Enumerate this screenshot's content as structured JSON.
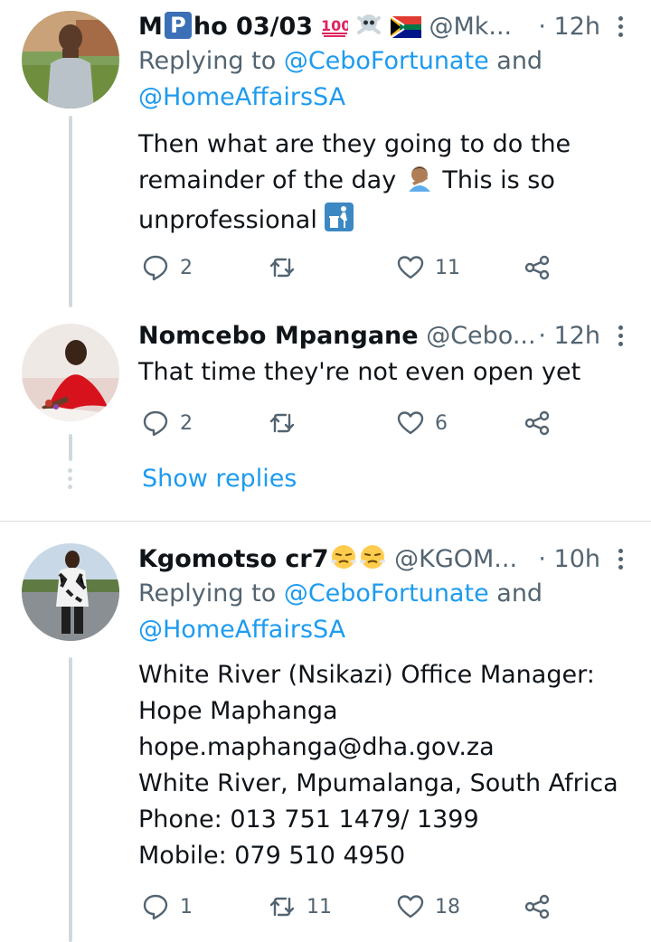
{
  "tweets": [
    {
      "name_pre": "M",
      "name_badge": "P",
      "name_post": "ho 03/03",
      "handle": "@Mk...",
      "time": "· 12h",
      "reply_prefix": "Replying to ",
      "reply_mention1": "@CeboFortunate",
      "reply_and": " and",
      "reply_mention2": "@HomeAffairsSA",
      "text_line1": "Then what are they going to do the",
      "text_line2a": "remainder of the day ",
      "text_line2b": " This is so",
      "text_line3": "unprofessional ",
      "replies": "2",
      "retweets": "",
      "likes": "11"
    },
    {
      "name": "Nomcebo Mpangane",
      "handle": "@Cebo...",
      "time": "· 12h",
      "text": "That time they're not even open yet",
      "replies": "2",
      "retweets": "",
      "likes": "6"
    },
    {
      "name": "Kgomotso cr7",
      "handle": "@KGOM...",
      "time": "· 10h",
      "reply_prefix": "Replying to ",
      "reply_mention1": "@CeboFortunate",
      "reply_and": " and",
      "reply_mention2": "@HomeAffairsSA",
      "lines": [
        "White River (Nsikazi) Office Manager:",
        "Hope Maphanga",
        "hope.maphanga@dha.gov.za",
        "White River, Mpumalanga, South Africa",
        "Phone: 013 751 1479/ 1399",
        "Mobile: 079 510 4950"
      ],
      "replies": "1",
      "retweets": "11",
      "likes": "18"
    }
  ],
  "show_replies": "Show replies",
  "colors": {
    "accent": "#1d9bf0",
    "muted": "#536471",
    "thread": "#cfd9de"
  }
}
